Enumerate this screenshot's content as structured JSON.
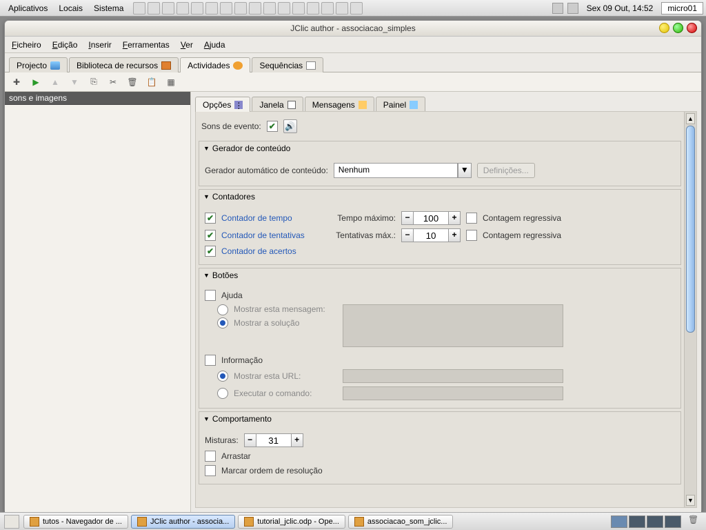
{
  "desktop": {
    "menu": [
      "Aplicativos",
      "Locais",
      "Sistema"
    ],
    "clock": "Sex 09 Out, 14:52",
    "host": "micro01"
  },
  "window": {
    "title": "JClic author - associacao_simples"
  },
  "menubar": {
    "ficheiro": "Ficheiro",
    "edicao": "Edição",
    "inserir": "Inserir",
    "ferramentas": "Ferramentas",
    "ver": "Ver",
    "ajuda": "Ajuda"
  },
  "main_tabs": {
    "projecto": "Projecto",
    "biblioteca": "Biblioteca de recursos",
    "actividades": "Actividades",
    "sequencias": "Sequências"
  },
  "sidebar": {
    "item": "sons e imagens"
  },
  "sub_tabs": {
    "opcoes": "Opções",
    "janela": "Janela",
    "mensagens": "Mensagens",
    "painel": "Painel"
  },
  "sons_evento": {
    "label": "Sons de evento:"
  },
  "gerador": {
    "header": "Gerador de conteúdo",
    "auto_label": "Gerador automático de conteúdo:",
    "select_value": "Nenhum",
    "definicoes": "Definições..."
  },
  "contadores": {
    "header": "Contadores",
    "tempo": "Contador de tempo",
    "tempo_max_label": "Tempo máximo:",
    "tempo_max_val": "100",
    "tempo_regressiva": "Contagem regressiva",
    "tentativas": "Contador de tentativas",
    "tentativas_max_label": "Tentativas máx.:",
    "tentativas_max_val": "10",
    "tentativas_regressiva": "Contagem regressiva",
    "acertos": "Contador de acertos"
  },
  "botoes": {
    "header": "Botões",
    "ajuda": "Ajuda",
    "mostrar_msg": "Mostrar esta mensagem:",
    "mostrar_sol": "Mostrar a solução",
    "informacao": "Informação",
    "mostrar_url": "Mostrar esta URL:",
    "executar_cmd": "Executar o comando:"
  },
  "comportamento": {
    "header": "Comportamento",
    "misturas_label": "Misturas:",
    "misturas_val": "31",
    "arrastar": "Arrastar",
    "marcar_ordem": "Marcar ordem de resolução"
  },
  "taskbar": {
    "t1": "tutos - Navegador de ...",
    "t2": "JClic author - associa...",
    "t3": "tutorial_jclic.odp - Ope...",
    "t4": "associacao_som_jclic..."
  }
}
